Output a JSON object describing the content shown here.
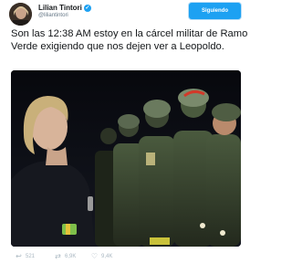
{
  "header": {
    "display_name": "Lilian Tintori",
    "verified_glyph": "✓",
    "handle": "@liliantintori",
    "follow_button_label": "Siguiendo"
  },
  "tweet": {
    "text": "Son las 12:38 AM estoy en la cárcel militar de Ramo Verde exigiendo que nos dejen ver a Leopoldo."
  },
  "photo": {
    "icon": "photo-of-woman-facing-soldiers"
  },
  "actions": {
    "replies": "521",
    "retweets": "6,9K",
    "likes": "9,4K",
    "reply_icon": "reply-icon",
    "retweet_icon": "retweet-icon",
    "like_icon": "heart-icon"
  },
  "colors": {
    "accent": "#1da1f2",
    "text": "#14171a",
    "muted": "#657786"
  }
}
